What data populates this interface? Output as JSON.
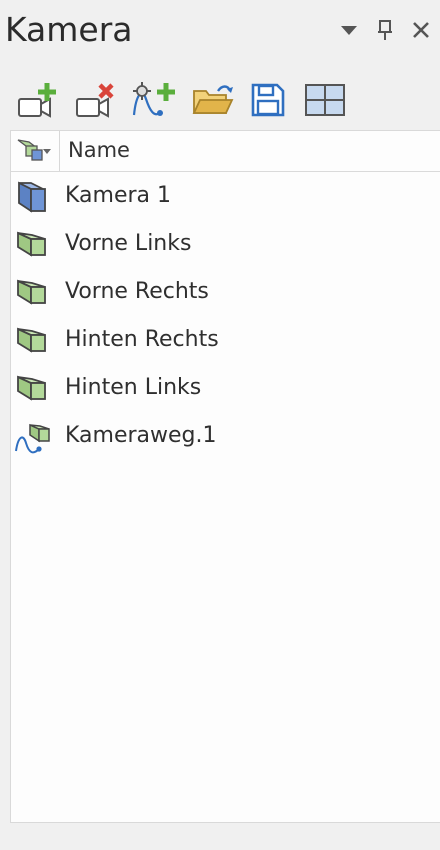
{
  "panel": {
    "title": "Kamera"
  },
  "title_actions": [
    {
      "name": "dropdown-icon"
    },
    {
      "name": "pin-icon"
    },
    {
      "name": "close-icon"
    }
  ],
  "toolbar": {
    "tools": [
      {
        "name": "add-camera-icon"
      },
      {
        "name": "remove-camera-icon"
      },
      {
        "name": "add-camera-path-icon"
      },
      {
        "name": "open-folder-icon"
      },
      {
        "name": "save-icon"
      },
      {
        "name": "layout-grid-icon"
      }
    ]
  },
  "list": {
    "header": {
      "name_label": "Name",
      "icon": "camera-type-icon"
    },
    "items": [
      {
        "label": "Kamera 1",
        "icon": "camera-blue-icon"
      },
      {
        "label": "Vorne Links",
        "icon": "camera-green-icon"
      },
      {
        "label": "Vorne Rechts",
        "icon": "camera-green-icon"
      },
      {
        "label": "Hinten Rechts",
        "icon": "camera-green-icon"
      },
      {
        "label": "Hinten Links",
        "icon": "camera-green-icon"
      },
      {
        "label": "Kameraweg.1",
        "icon": "camera-path-icon"
      }
    ]
  },
  "colors": {
    "background": "#f0f0f0",
    "panel": "#fdfdfd",
    "camera_blue": "#6f95d6",
    "camera_green": "#b3d99a",
    "add_green": "#5aae3c",
    "remove_red": "#d9443a",
    "accent_blue": "#2f6fc0",
    "folder": "#e2b44a"
  }
}
